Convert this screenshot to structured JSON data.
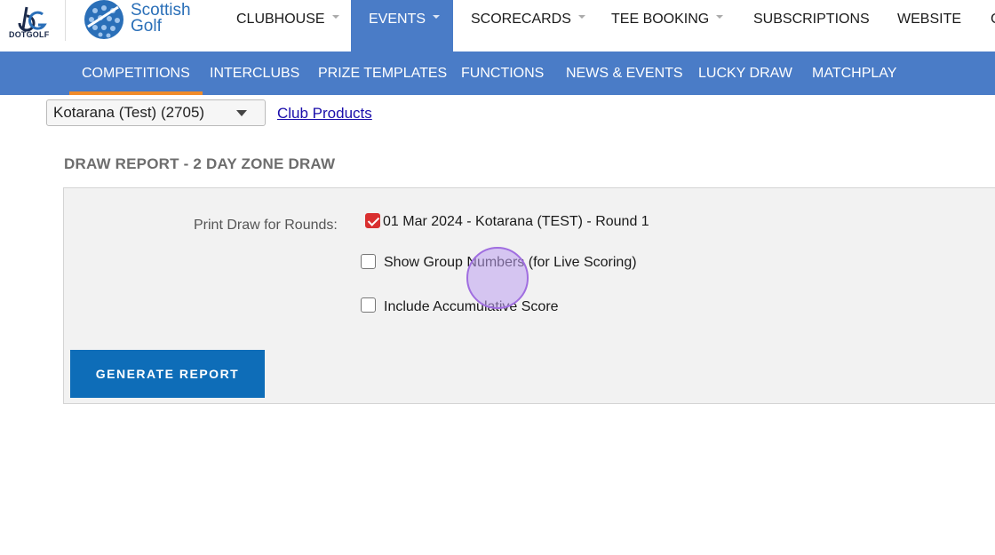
{
  "logos": {
    "dotgolf_text": "DOTGOLF",
    "dotgolf_mark": "dG",
    "scottish_golf_line1": "Scottish",
    "scottish_golf_line2": "Golf"
  },
  "top_nav": {
    "items": [
      {
        "label": "CLUBHOUSE",
        "has_caret": true,
        "active": false
      },
      {
        "label": "EVENTS",
        "has_caret": true,
        "active": true
      },
      {
        "label": "SCORECARDS",
        "has_caret": true,
        "active": false
      },
      {
        "label": "TEE BOOKING",
        "has_caret": true,
        "active": false
      },
      {
        "label": "SUBSCRIPTIONS",
        "has_caret": false,
        "active": false
      },
      {
        "label": "WEBSITE",
        "has_caret": false,
        "active": false
      },
      {
        "label": "C",
        "has_caret": false,
        "active": false
      }
    ]
  },
  "sub_nav": {
    "items": [
      {
        "label": "COMPETITIONS",
        "active": true
      },
      {
        "label": "INTERCLUBS",
        "active": false
      },
      {
        "label": "PRIZE TEMPLATES",
        "active": false
      },
      {
        "label": "FUNCTIONS",
        "active": false
      },
      {
        "label": "NEWS & EVENTS",
        "active": false
      },
      {
        "label": "LUCKY DRAW",
        "active": false
      },
      {
        "label": "MATCHPLAY",
        "active": false
      }
    ]
  },
  "club_selector": {
    "value": "Kotarana (Test) (2705)"
  },
  "club_products_link": "Club Products",
  "report": {
    "title": "DRAW REPORT - 2 DAY ZONE DRAW",
    "rounds_label": "Print Draw for Rounds:",
    "options": [
      {
        "label": "01 Mar 2024 - Kotarana (TEST) - Round 1",
        "checked": true
      },
      {
        "label": "Show Group Numbers (for Live Scoring)",
        "checked": false
      },
      {
        "label": "Include Accumulative Score",
        "checked": false
      }
    ],
    "generate_button": "GENERATE REPORT"
  },
  "colors": {
    "nav_blue": "#4a7cc7",
    "active_underline": "#f08b2a",
    "button_blue": "#0e6db8",
    "checkbox_checked": "#d93030"
  }
}
